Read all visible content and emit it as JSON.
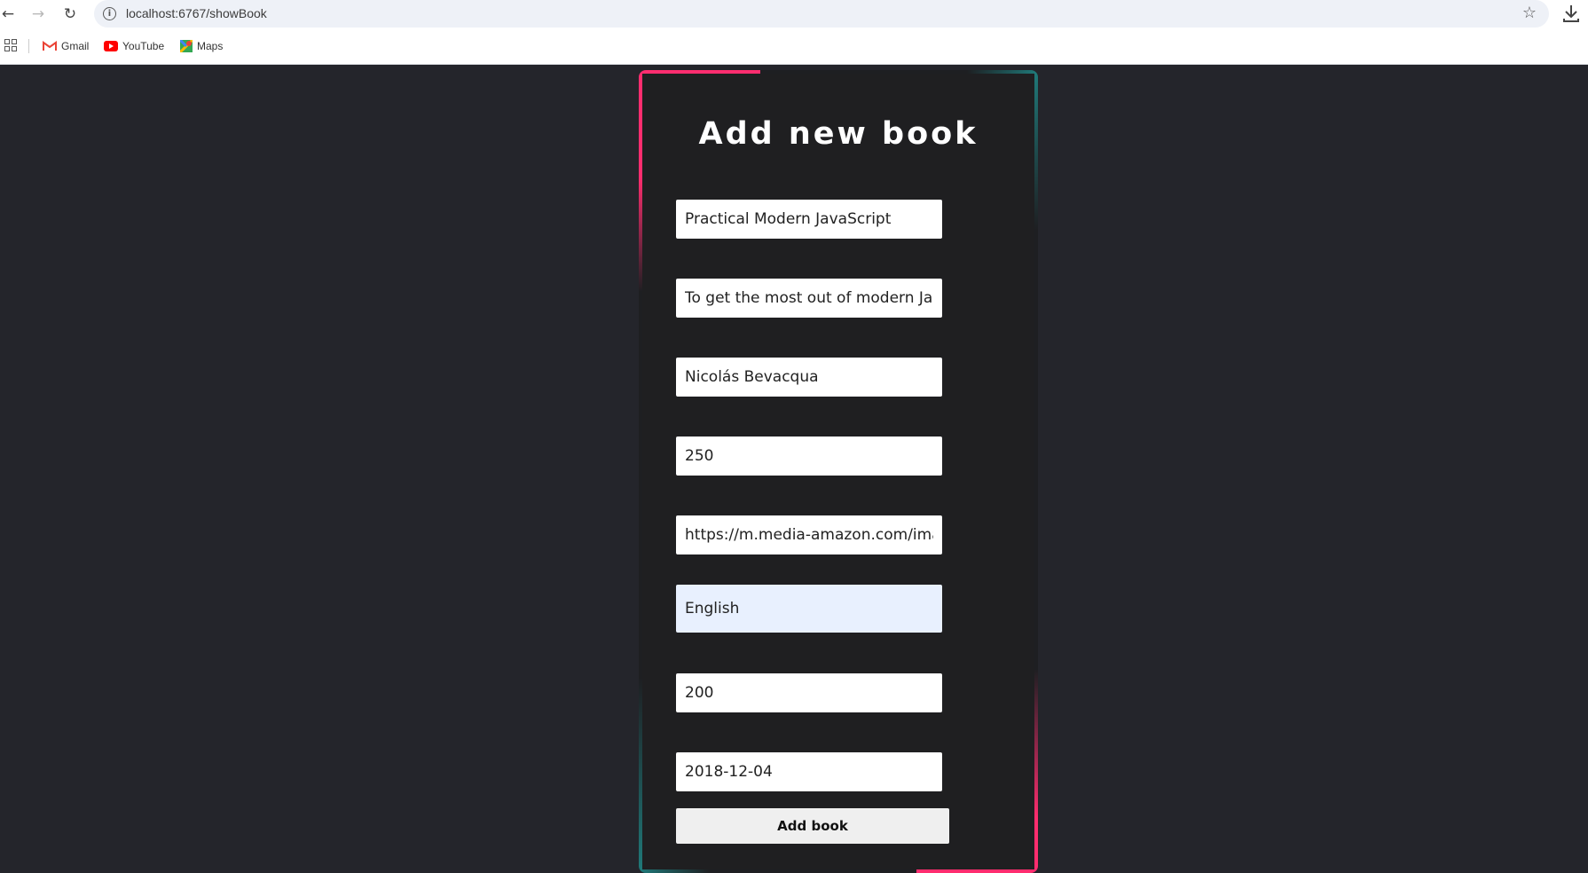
{
  "browser": {
    "url": "localhost:6767/showBook",
    "bookmarks": [
      {
        "label": "Gmail",
        "icon": "gmail-icon"
      },
      {
        "label": "YouTube",
        "icon": "youtube-icon"
      },
      {
        "label": "Maps",
        "icon": "maps-icon"
      }
    ]
  },
  "form": {
    "title": "Add new book",
    "fields": {
      "title": "Practical Modern JavaScript",
      "description": "To get the most out of modern JavaScript",
      "author": "Nicolás Bevacqua",
      "pages": "250",
      "image_url": "https://m.media-amazon.com/images",
      "language": "English",
      "price": "200",
      "published_date": "2018-12-04"
    },
    "submit_label": "Add book"
  },
  "colors": {
    "background": "#24252b",
    "card": "#1f1f21",
    "accent_pink": "#ff2d6f",
    "accent_teal": "#1f7a7a"
  }
}
